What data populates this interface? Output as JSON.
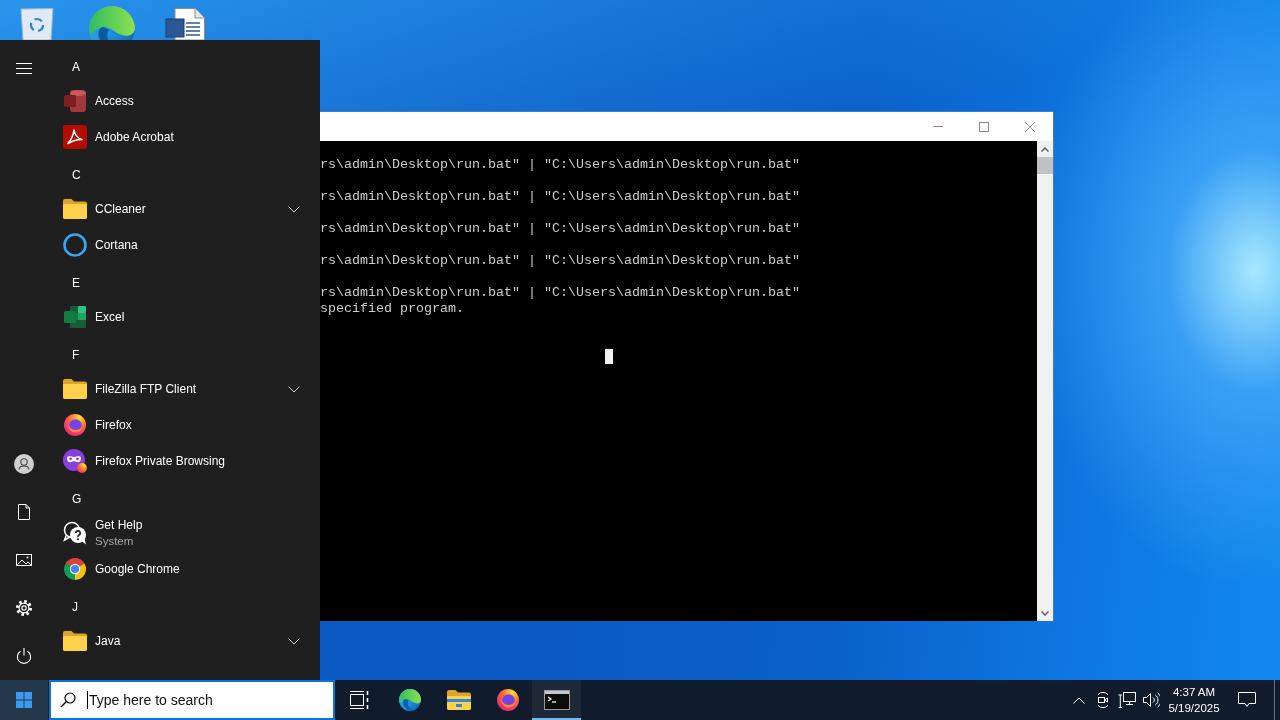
{
  "start_menu": {
    "sections": [
      {
        "letter": "A",
        "items": [
          {
            "kind": "access",
            "name": "Access"
          },
          {
            "kind": "acrobat",
            "name": "Adobe Acrobat"
          }
        ]
      },
      {
        "letter": "C",
        "items": [
          {
            "kind": "folder",
            "name": "CCleaner"
          },
          {
            "kind": "cortana",
            "name": "Cortana"
          }
        ]
      },
      {
        "letter": "E",
        "items": [
          {
            "kind": "excel",
            "name": "Excel"
          }
        ]
      },
      {
        "letter": "F",
        "items": [
          {
            "kind": "folder",
            "name": "FileZilla FTP Client"
          },
          {
            "kind": "firefox",
            "name": "Firefox"
          },
          {
            "kind": "private",
            "name": "Firefox Private Browsing"
          }
        ]
      },
      {
        "letter": "G",
        "items": [
          {
            "kind": "help",
            "name": "Get Help",
            "subtitle": "System"
          },
          {
            "kind": "chrome",
            "name": "Google Chrome"
          }
        ]
      },
      {
        "letter": "J",
        "items": [
          {
            "kind": "folder",
            "name": "Java"
          }
        ]
      }
    ]
  },
  "console_window": {
    "lines": [
      {
        "kind": "command",
        "text": "rs\\admin\\Desktop\\run.bat\" | \"C:\\Users\\admin\\Desktop\\run.bat\""
      },
      {
        "kind": "command",
        "text": "rs\\admin\\Desktop\\run.bat\" | \"C:\\Users\\admin\\Desktop\\run.bat\""
      },
      {
        "kind": "command",
        "text": "rs\\admin\\Desktop\\run.bat\" | \"C:\\Users\\admin\\Desktop\\run.bat\""
      },
      {
        "kind": "command",
        "text": "rs\\admin\\Desktop\\run.bat\" | \"C:\\Users\\admin\\Desktop\\run.bat\""
      },
      {
        "kind": "command",
        "text": "rs\\admin\\Desktop\\run.bat\" | \"C:\\Users\\admin\\Desktop\\run.bat\""
      },
      {
        "kind": "output",
        "text": "specified program."
      }
    ]
  },
  "taskbar": {
    "search": {
      "placeholder": "Type here to search"
    },
    "apps": [
      {
        "kind": "edge",
        "running": false
      },
      {
        "kind": "explorer",
        "running": false
      },
      {
        "kind": "firefox",
        "running": false
      },
      {
        "kind": "terminal",
        "running": true
      }
    ],
    "clock": {
      "time": "4:37 AM",
      "date": "5/19/2025"
    }
  }
}
